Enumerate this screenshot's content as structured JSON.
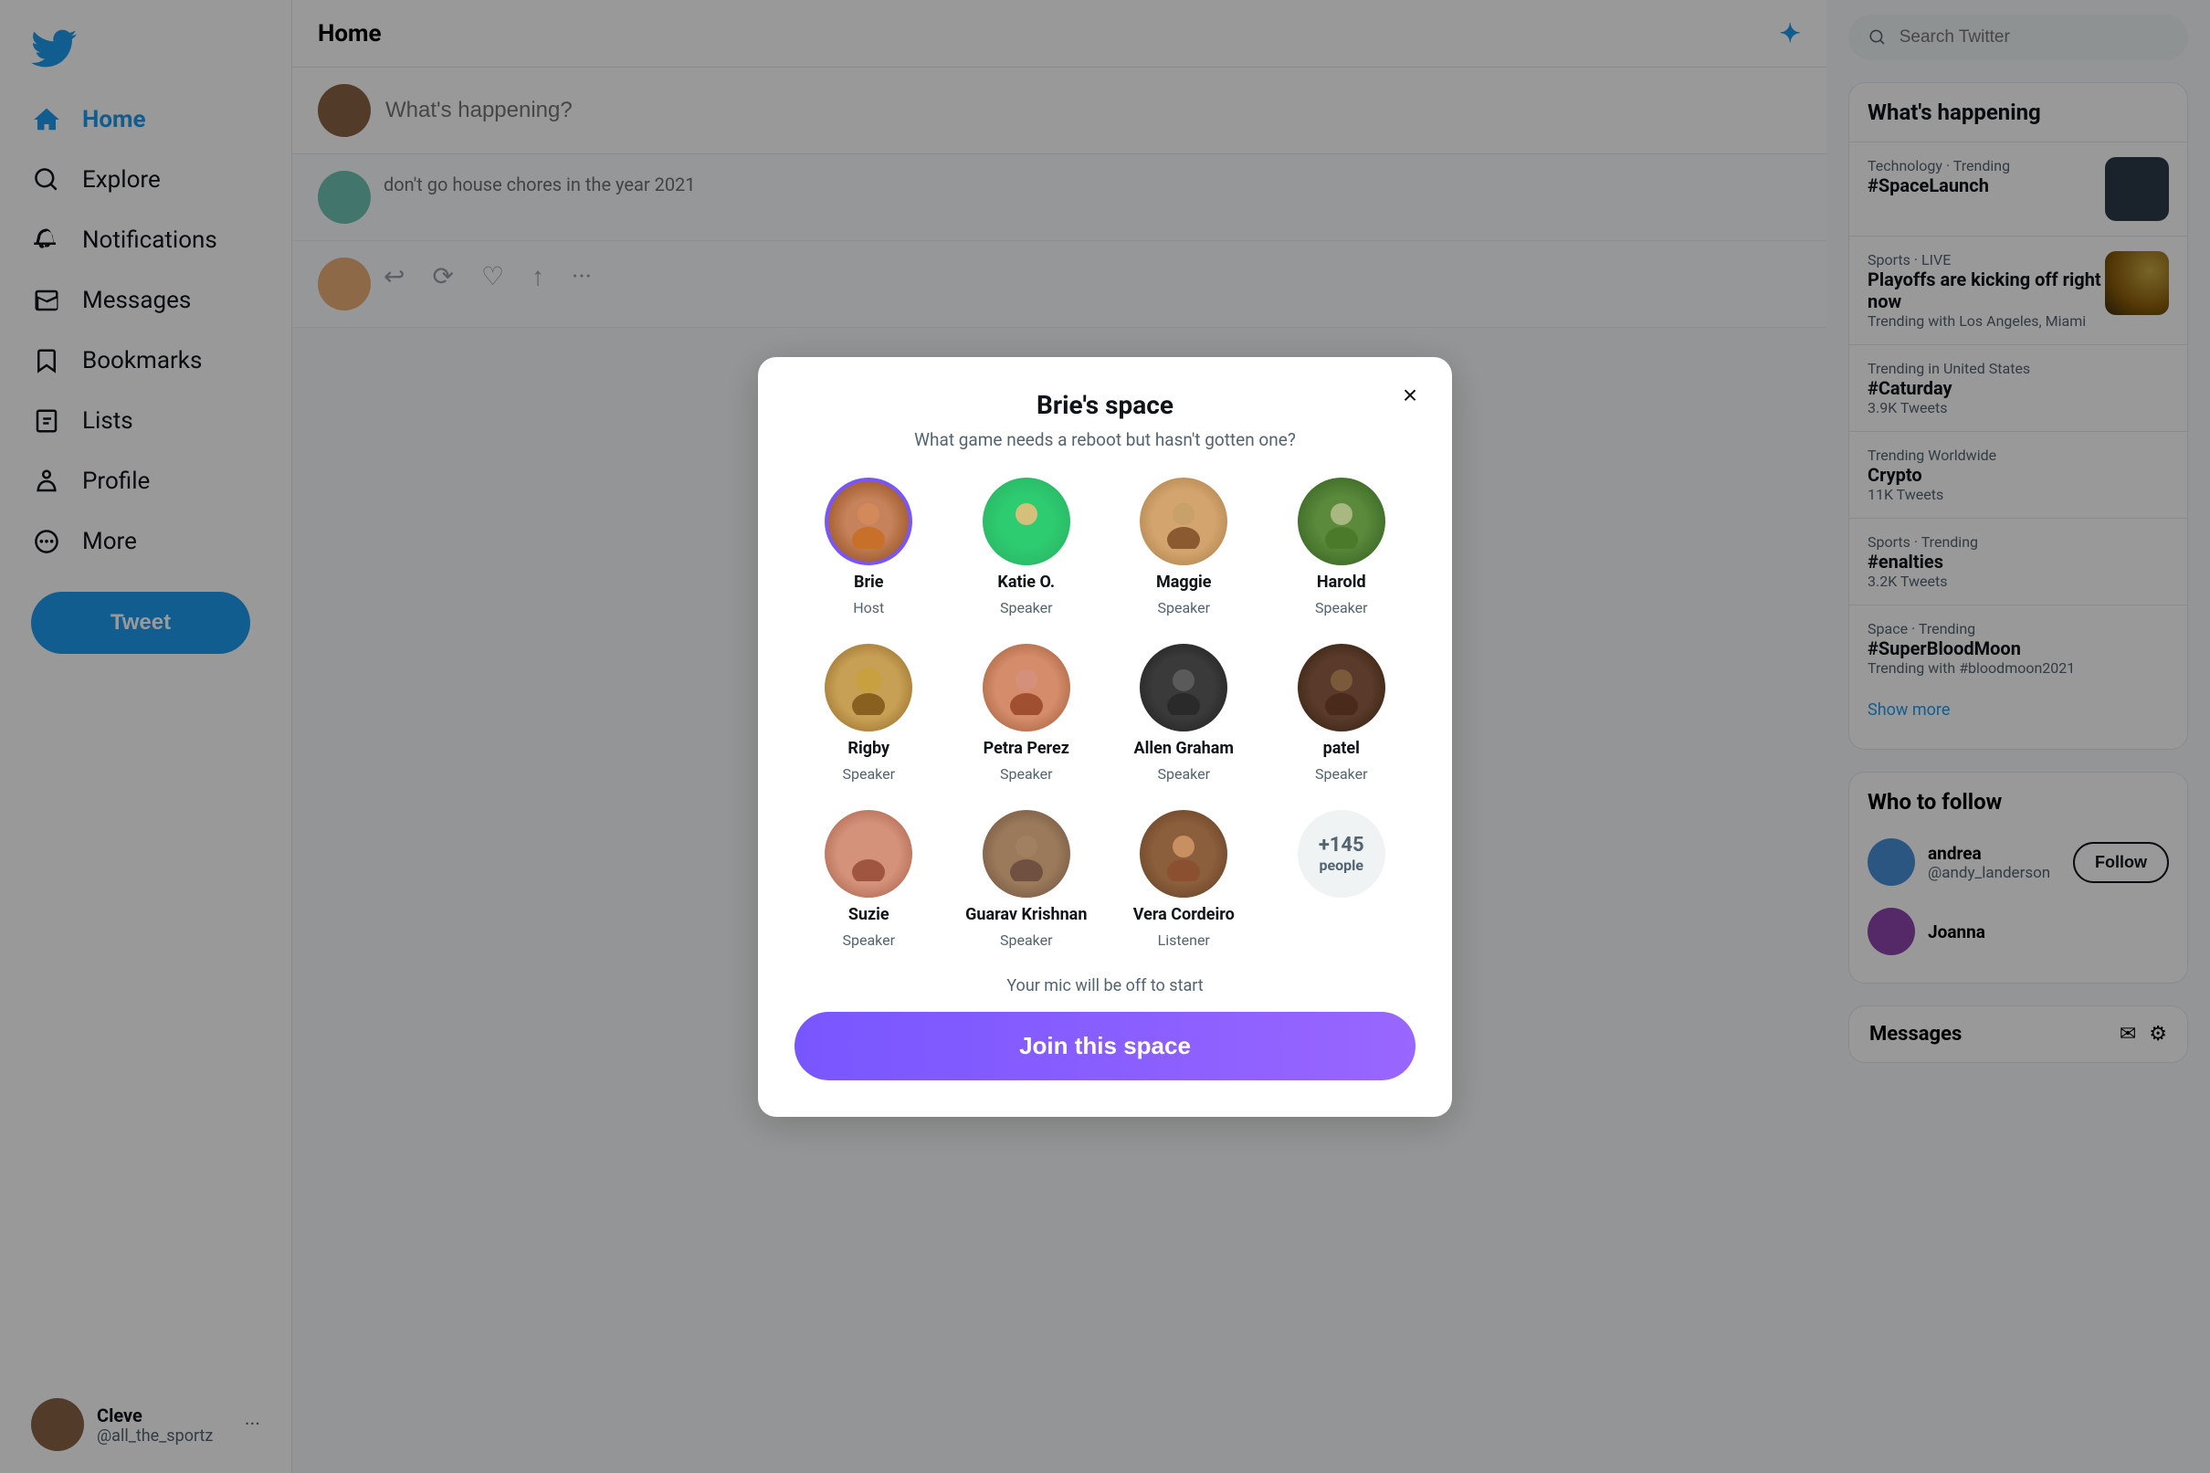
{
  "sidebar": {
    "logo_label": "Twitter",
    "nav_items": [
      {
        "id": "home",
        "label": "Home",
        "active": true
      },
      {
        "id": "explore",
        "label": "Explore",
        "active": false
      },
      {
        "id": "notifications",
        "label": "Notifications",
        "active": false
      },
      {
        "id": "messages",
        "label": "Messages",
        "active": false
      },
      {
        "id": "bookmarks",
        "label": "Bookmarks",
        "active": false
      },
      {
        "id": "lists",
        "label": "Lists",
        "active": false
      },
      {
        "id": "profile",
        "label": "Profile",
        "active": false
      },
      {
        "id": "more",
        "label": "More",
        "active": false
      }
    ],
    "tweet_button": "Tweet",
    "profile": {
      "name": "Cleve",
      "handle": "@all_the_sportz"
    }
  },
  "main": {
    "header": "Home",
    "compose_placeholder": "What's happening?"
  },
  "right": {
    "search_placeholder": "Search Twitter",
    "what_happening_title": "What's happening",
    "trending_items": [
      {
        "label": "Technology · Trending",
        "name": "#SpaceLaunch",
        "count": null,
        "has_image": true
      },
      {
        "label": "Sports · LIVE",
        "name": "Playoffs are kicking off right now",
        "count": "Trending with Los Angeles, Miami",
        "has_image": true
      },
      {
        "label": "Trending in United States",
        "name": "#Caturday",
        "count": "3.9K Tweets",
        "has_image": false
      },
      {
        "label": "Trending Worldwide",
        "name": "Crypto",
        "count": "11K Tweets",
        "has_image": false
      },
      {
        "label": "Sports · Trending",
        "name": "#enalties",
        "count": "3.2K Tweets",
        "has_image": false
      },
      {
        "label": "Space · Trending",
        "name": "#SuperBloodMoon",
        "count": "Trending with #bloodmoon2021",
        "has_image": false
      }
    ],
    "show_more": "Show more",
    "who_to_follow_title": "Who to follow",
    "follow_items": [
      {
        "name": "andrea",
        "handle": "@andy_landerson"
      },
      {
        "name": "Joanna",
        "handle": ""
      }
    ],
    "follow_label": "Follow",
    "messages_title": "Messages"
  },
  "modal": {
    "title": "Brie's space",
    "subtitle": "What game needs a reboot but hasn't gotten one?",
    "close_label": "×",
    "speakers": [
      {
        "name": "Brie",
        "role": "Host",
        "avatar_class": "av-brie"
      },
      {
        "name": "Katie O.",
        "role": "Speaker",
        "avatar_class": "av-katie"
      },
      {
        "name": "Maggie",
        "role": "Speaker",
        "avatar_class": "av-maggie"
      },
      {
        "name": "Harold",
        "role": "Speaker",
        "avatar_class": "av-harold"
      },
      {
        "name": "Rigby",
        "role": "Speaker",
        "avatar_class": "av-rigby"
      },
      {
        "name": "Petra Perez",
        "role": "Speaker",
        "avatar_class": "av-petra"
      },
      {
        "name": "Allen Graham",
        "role": "Speaker",
        "avatar_class": "av-allen"
      },
      {
        "name": "patel",
        "role": "Speaker",
        "avatar_class": "av-patel"
      },
      {
        "name": "Suzie",
        "role": "Speaker",
        "avatar_class": "av-suzie"
      },
      {
        "name": "Guarav Krishnan",
        "role": "Speaker",
        "avatar_class": "av-guarav"
      },
      {
        "name": "Vera Cordeiro",
        "role": "Listener",
        "avatar_class": "av-vera"
      }
    ],
    "plus_count": "+145",
    "plus_label": "people",
    "mic_notice": "Your mic will be off to start",
    "join_label": "Join this space"
  }
}
